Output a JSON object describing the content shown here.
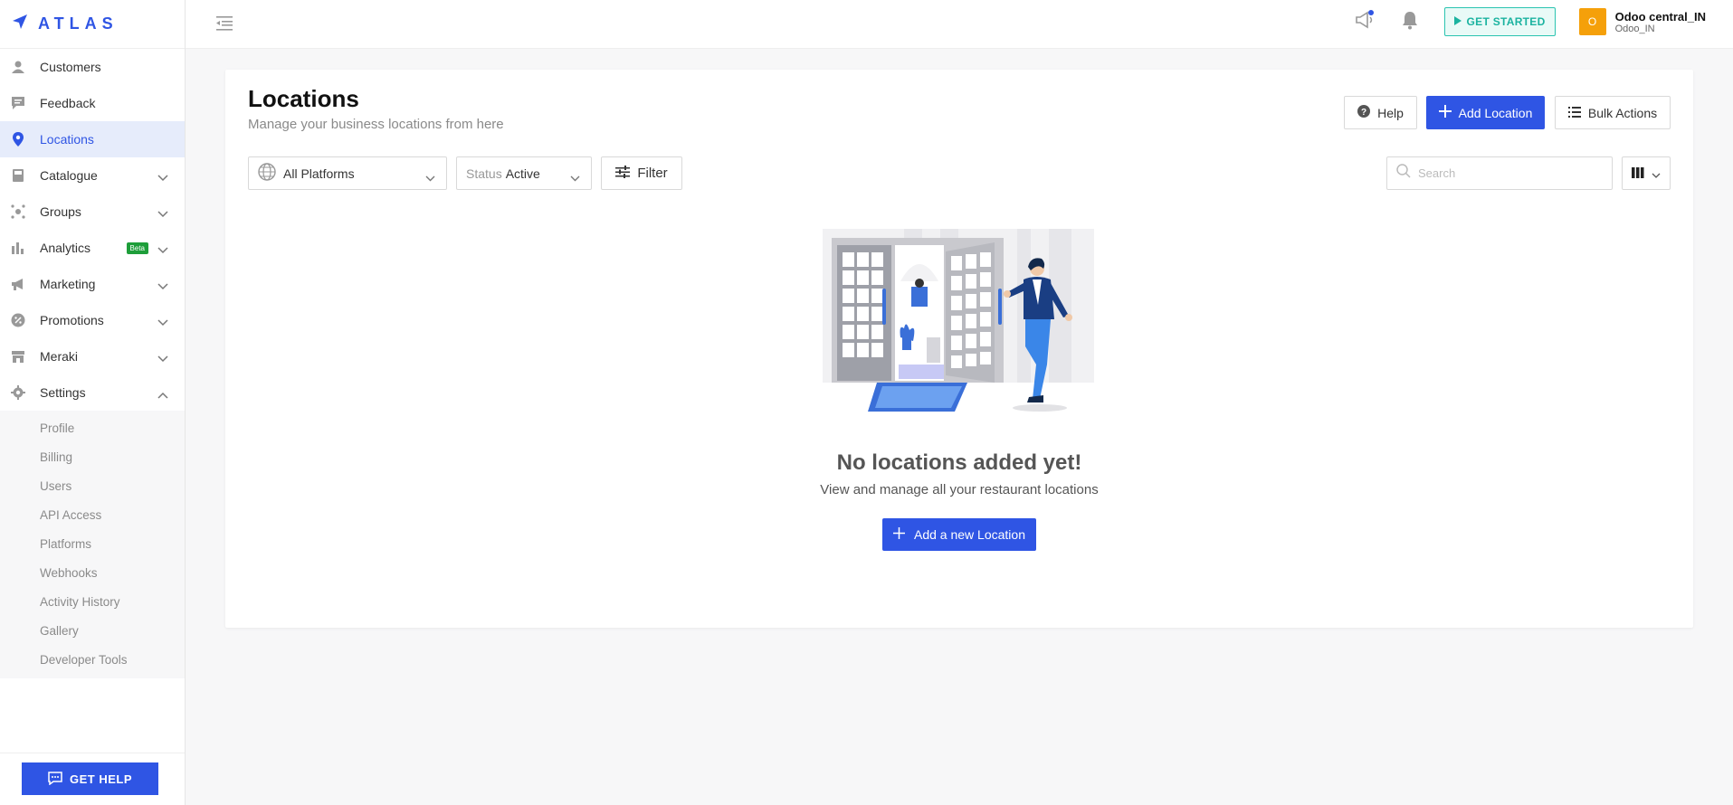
{
  "brand": {
    "name": "ATLAS",
    "color": "#2f55e4"
  },
  "sidebar": {
    "items": [
      {
        "label": "Customers",
        "icon": "customers-icon"
      },
      {
        "label": "Feedback",
        "icon": "feedback-icon"
      },
      {
        "label": "Locations",
        "icon": "location-pin-icon",
        "active": true
      },
      {
        "label": "Catalogue",
        "icon": "catalogue-icon",
        "expandable": true
      },
      {
        "label": "Groups",
        "icon": "groups-icon",
        "expandable": true
      },
      {
        "label": "Analytics",
        "icon": "analytics-icon",
        "expandable": true,
        "badge": "Beta"
      },
      {
        "label": "Marketing",
        "icon": "megaphone-icon",
        "expandable": true
      },
      {
        "label": "Promotions",
        "icon": "promotions-icon",
        "expandable": true
      },
      {
        "label": "Meraki",
        "icon": "store-icon",
        "expandable": true
      },
      {
        "label": "Settings",
        "icon": "gear-icon",
        "expandable": true,
        "expanded": true
      }
    ],
    "settings_sub": [
      "Profile",
      "Billing",
      "Users",
      "API Access",
      "Platforms",
      "Webhooks",
      "Activity History",
      "Gallery",
      "Developer Tools"
    ],
    "get_help_label": "GET HELP"
  },
  "topbar": {
    "get_started_label": "GET STARTED",
    "avatar_letter": "O",
    "account_name": "Odoo central_IN",
    "account_sub": "Odoo_IN"
  },
  "main": {
    "title": "Locations",
    "subtitle": "Manage your business locations from here",
    "help_label": "Help",
    "add_location_label": "Add Location",
    "bulk_actions_label": "Bulk Actions",
    "platform_select": "All Platforms",
    "status_label": "Status",
    "status_value": "Active",
    "filter_label": "Filter",
    "search_placeholder": "Search",
    "empty_title": "No locations added yet!",
    "empty_text": "View and manage all your restaurant locations",
    "add_new_label": "Add a new Location"
  },
  "colors": {
    "primary": "#2f55e4",
    "accent_teal": "#1bb3a0",
    "avatar": "#f5a00a",
    "beta_badge": "#1e9e3a"
  }
}
